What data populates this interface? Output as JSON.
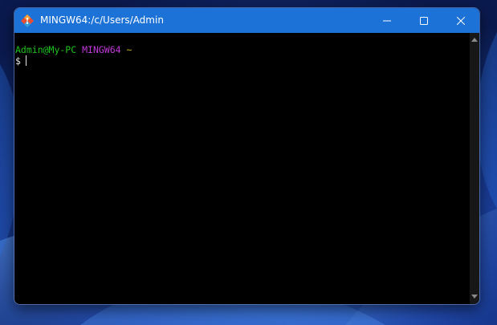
{
  "window": {
    "title": "MINGW64:/c/Users/Admin",
    "icon": "git-diamond-icon",
    "title_bar_color": "#1c72d6"
  },
  "caption_buttons": {
    "minimize_icon": "minimize-icon",
    "maximize_icon": "maximize-icon",
    "close_icon": "close-icon"
  },
  "terminal": {
    "background": "#000000",
    "prompt": {
      "user_host": "Admin@My-PC",
      "shell": "MINGW64",
      "cwd": "~",
      "symbol": "$"
    },
    "colors": {
      "user_host": "#1ec41e",
      "shell": "#c13ad9",
      "cwd": "#c8b21e"
    }
  }
}
